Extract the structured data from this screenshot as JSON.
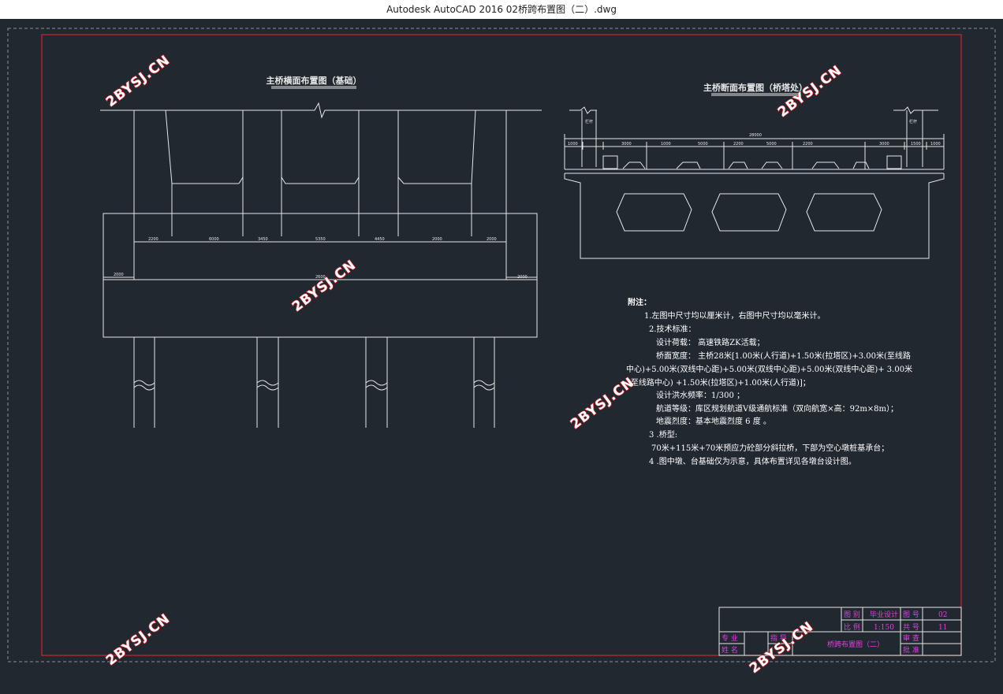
{
  "window": {
    "title": "Autodesk AutoCAD 2016     02桥跨布置图（二）.dwg"
  },
  "drawing": {
    "left_title": "主桥横面布置图（基础）",
    "right_title": "主桥断面布置图（桥塔处）",
    "left_dims_top": [
      "2200",
      "6000",
      "3450",
      "5350",
      "4450",
      "2000",
      "2000"
    ],
    "left_dims_side": [
      "2000",
      "2000"
    ],
    "left_dim_center": "2600",
    "right_dim_total": "28000",
    "right_dims": [
      "1000",
      "3000",
      "1000",
      "5000",
      "2200",
      "5000",
      "2200",
      "3000",
      "1500",
      "1000"
    ],
    "right_labels": {
      "rail_left": "栏杆",
      "rail_right": "栏杆"
    }
  },
  "notes": {
    "title": "附注：",
    "lines": [
      "1.左图中尺寸均以厘米计，右图中尺寸均以毫米计。",
      "2.技术标准：",
      "设计荷载：  高速铁路ZK活载；",
      "桥面宽度：  主桥28米[1.00米(人行道)+1.50米(拉塔区)+3.00米(至线路",
      "中心)+5.00米(双线中心距)+5.00米(双线中心距)+5.00米(双线中心距)+ 3.00米",
      "(至线路中心) +1.50米(拉塔区)+1.00米(人行道)]；",
      "设计洪水频率：1/300 ；",
      "航道等级：库区规划航道Ⅴ级通航标准（双向航宽×高：92m×8m）；",
      "地震烈度：基本地震烈度 6 度 。",
      "3 .桥型:",
      "70米+115米+70米预应力砼部分斜拉桥，下部为空心墩桩基承台；",
      "4 .图中墩、台基础仅为示意，具体布置详见各墩台设计图。"
    ]
  },
  "title_block": {
    "drawing_name": "桥跨布置图（二）",
    "label_tu_bie": "图 别",
    "value_tu_bie": "毕业设计",
    "label_bi_li": "比 例",
    "value_bi_li": "1:150",
    "label_tu_hao": "图 号",
    "value_tu_hao": "02",
    "label_gong": "共 号",
    "value_gong": "11",
    "label_zhuanye": "专 业",
    "label_xingming": "姓 名",
    "label_zhidao": "指 导",
    "label_shencha": "审 查",
    "label_pizhun": "批 准"
  },
  "watermark": "2BYSJ.CN",
  "colors": {
    "background": "#212830",
    "border": "#d2242c",
    "lines": "#e6e6e6",
    "magenta": "#e040e0"
  }
}
